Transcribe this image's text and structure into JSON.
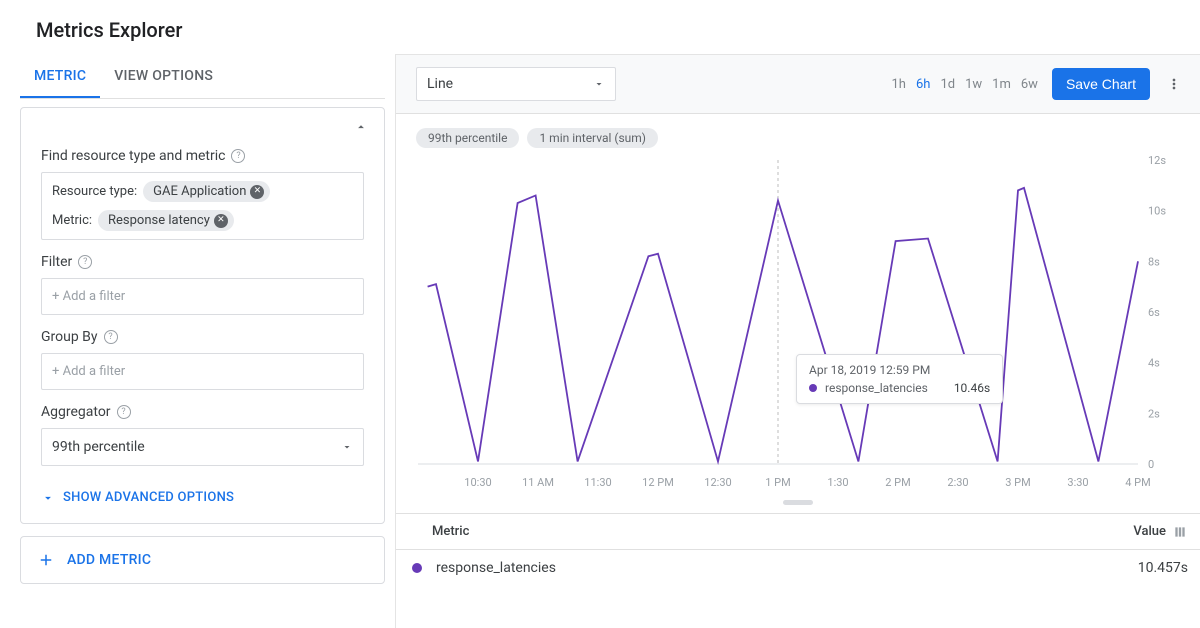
{
  "page_title": "Metrics Explorer",
  "tabs": {
    "metric": "METRIC",
    "view_options": "VIEW OPTIONS"
  },
  "find": {
    "title": "Find resource type and metric",
    "resource_type_label": "Resource type:",
    "resource_type_value": "GAE Application",
    "metric_label": "Metric:",
    "metric_value": "Response latency"
  },
  "filter": {
    "title": "Filter",
    "placeholder": "+ Add a filter"
  },
  "groupby": {
    "title": "Group By",
    "placeholder": "+ Add a filter"
  },
  "aggregator": {
    "title": "Aggregator",
    "value": "99th percentile"
  },
  "advanced_label": "SHOW ADVANCED OPTIONS",
  "add_metric_label": "ADD METRIC",
  "toolbar": {
    "chart_type": "Line",
    "ranges": [
      "1h",
      "6h",
      "1d",
      "1w",
      "1m",
      "6w"
    ],
    "active_range_index": 1,
    "save_label": "Save Chart"
  },
  "chart_chips": [
    "99th percentile",
    "1 min interval (sum)"
  ],
  "tooltip": {
    "time": "Apr 18, 2019 12:59 PM",
    "series": "response_latencies",
    "value": "10.46s"
  },
  "legend": {
    "metric_header": "Metric",
    "value_header": "Value",
    "row_name": "response_latencies",
    "row_value": "10.457s"
  },
  "chart_data": {
    "type": "line",
    "title": "",
    "xlabel": "",
    "ylabel": "",
    "xticks": [
      "10:30",
      "11 AM",
      "11:30",
      "12 PM",
      "12:30",
      "1 PM",
      "1:30",
      "2 PM",
      "2:30",
      "3 PM",
      "3:30",
      "4 PM"
    ],
    "yticks": [
      "0",
      "2s",
      "4s",
      "6s",
      "8s",
      "10s",
      "12s"
    ],
    "ylim": [
      0,
      12
    ],
    "series": [
      {
        "name": "response_latencies",
        "color": "#673ab7",
        "x": [
          10.08,
          10.15,
          10.5,
          10.83,
          10.98,
          11.33,
          11.92,
          12.0,
          12.5,
          13.0,
          13.0,
          13.67,
          13.98,
          14.25,
          14.83,
          15.0,
          15.05,
          15.67,
          16.0
        ],
        "values": [
          7.0,
          7.1,
          0.1,
          10.3,
          10.6,
          0.1,
          8.2,
          8.3,
          0.1,
          10.4,
          10.4,
          0.1,
          8.8,
          8.9,
          0.1,
          10.8,
          10.9,
          0.1,
          8.0
        ]
      }
    ],
    "crosshair_x": 13.0
  }
}
